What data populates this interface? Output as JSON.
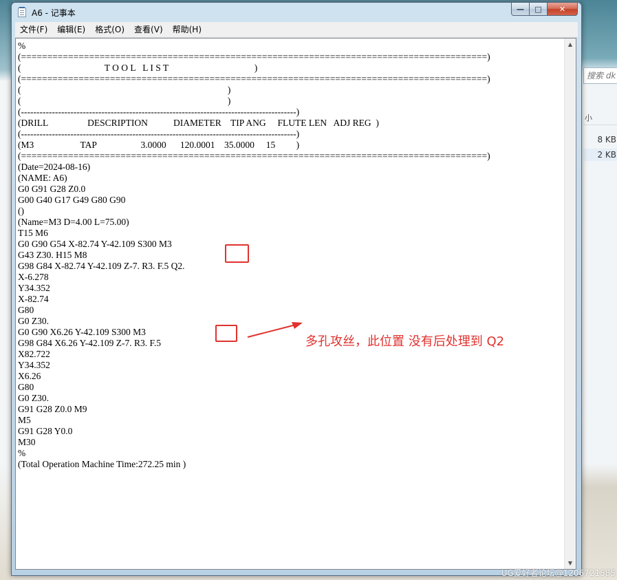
{
  "window": {
    "title": "A6 - 记事本",
    "min_label": "—",
    "max_label": "□",
    "close_label": "✕"
  },
  "menu": [
    {
      "label": "文件(F)"
    },
    {
      "label": "编辑(E)"
    },
    {
      "label": "格式(O)"
    },
    {
      "label": "查看(V)"
    },
    {
      "label": "帮助(H)"
    }
  ],
  "editor": {
    "lines": [
      "%",
      "(=========================================================================================)",
      "(                                    T O O L   L I S T                                     )",
      "(=========================================================================================)",
      "(                                                                                         )",
      "(                                                                                         )",
      "(-----------------------------------------------------------------------------------------)",
      "(DRILL                 DESCRIPTION           DIAMETER    TIP ANG     FLUTE LEN   ADJ REG  )",
      "(-----------------------------------------------------------------------------------------)",
      "(M3                    TAP                   3.0000      120.0001    35.0000     15         )",
      "(=========================================================================================)",
      "(Date=2024-08-16)",
      "(NAME: A6)",
      "G0 G91 G28 Z0.0",
      "G00 G40 G17 G49 G80 G90",
      "()",
      "(Name=M3 D=4.00 L=75.00)",
      "T15 M6",
      "G0 G90 G54 X-82.74 Y-42.109 S300 M3",
      "G43 Z30. H15 M8",
      "G98 G84 X-82.74 Y-42.109 Z-7. R3. F.5 Q2.",
      "X-6.278",
      "Y34.352",
      "X-82.74",
      "G80",
      "G0 Z30.",
      "G0 G90 X6.26 Y-42.109 S300 M3",
      "G98 G84 X6.26 Y-42.109 Z-7. R3. F.5",
      "X82.722",
      "Y34.352",
      "X6.26",
      "G80",
      "G0 Z30.",
      "G91 G28 Z0.0 M9",
      "M5",
      "G91 G28 Y0.0",
      "M30",
      "%",
      "(Total Operation Machine Time:272.25 min )"
    ]
  },
  "annotation": {
    "text": "多孔攻丝，此位置 没有后处理到 Q2",
    "color": "#e0322e"
  },
  "background": {
    "search_placeholder": "搜索 dk",
    "sizes": [
      "8 KB",
      "2 KB"
    ]
  },
  "watermark": "UG爱好者论坛@1206721585"
}
